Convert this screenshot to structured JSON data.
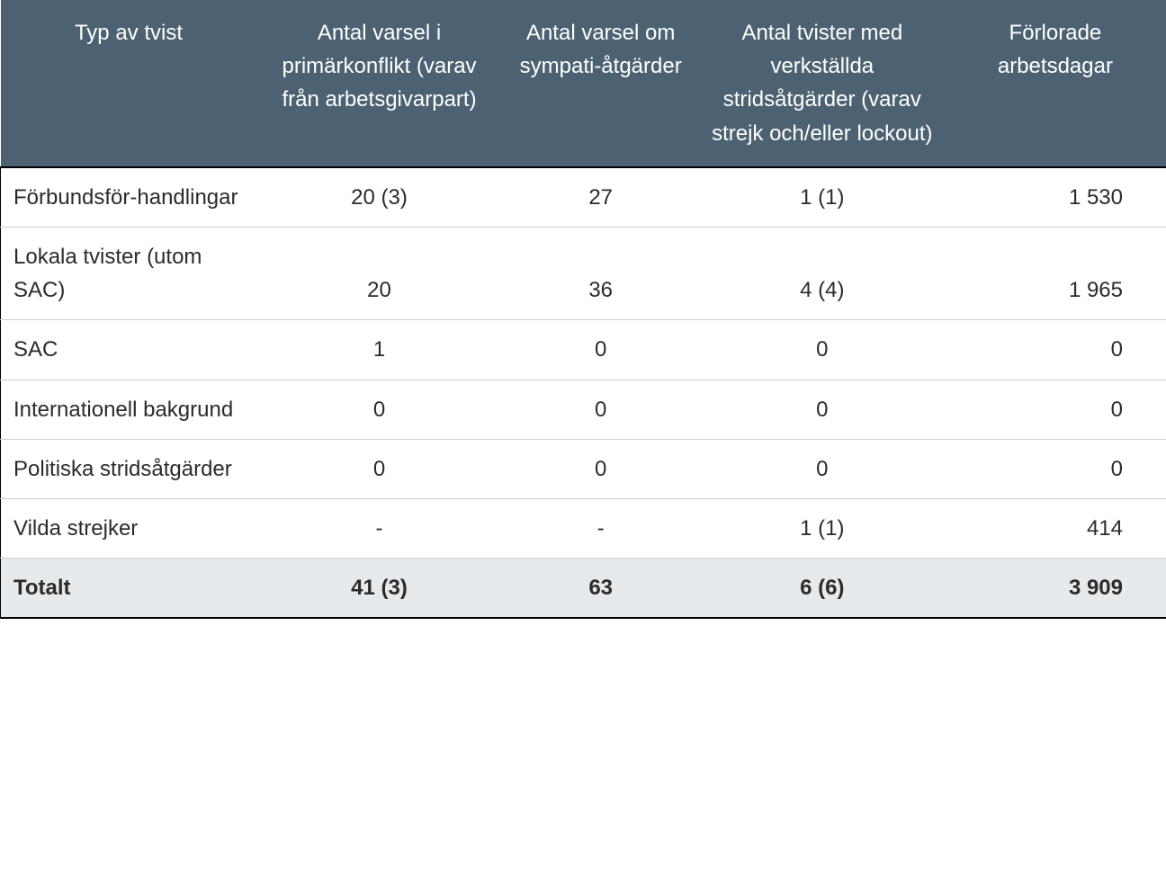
{
  "chart_data": {
    "type": "table",
    "headers": [
      "Typ av tvist",
      "Antal varsel i primärkonflikt (varav från arbetsgivarpart)",
      "Antal varsel om sympati-åtgärder",
      "Antal tvister med verkställda stridsåtgärder (varav strejk och/eller lockout)",
      "Förlorade arbetsdagar"
    ],
    "rows": [
      {
        "label": "Förbundsför-handlingar",
        "c2": "20 (3)",
        "c3": "27",
        "c4": "1 (1)",
        "c5": "1 530"
      },
      {
        "label": "Lokala tvister (utom SAC)",
        "c2": "20",
        "c3": "36",
        "c4": "4 (4)",
        "c5": "1 965"
      },
      {
        "label": "SAC",
        "c2": "1",
        "c3": "0",
        "c4": "0",
        "c5": "0"
      },
      {
        "label": "Internationell bakgrund",
        "c2": "0",
        "c3": "0",
        "c4": "0",
        "c5": "0"
      },
      {
        "label": "Politiska stridsåtgärder",
        "c2": "0",
        "c3": "0",
        "c4": "0",
        "c5": "0"
      },
      {
        "label": "Vilda strejker",
        "c2": "-",
        "c3": "-",
        "c4": "1 (1)",
        "c5": "414"
      }
    ],
    "total": {
      "label": "Totalt",
      "c2": "41 (3)",
      "c3": "63",
      "c4": "6 (6)",
      "c5": "3 909"
    }
  }
}
